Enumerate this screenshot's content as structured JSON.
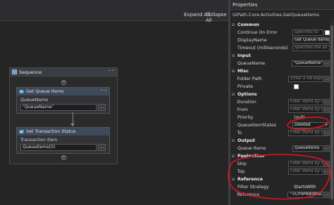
{
  "designer": {
    "expand_all": "Expand All",
    "collapse_all": "Collapse All",
    "sequence": {
      "title": "Sequence",
      "activities": [
        {
          "title": "Get Queue Items",
          "field_label": "QueueName",
          "field_value": "\"QueueName\""
        },
        {
          "title": "Set Transaction Status",
          "field_label": "Transaction Item",
          "field_value": "QueueItems(0)"
        }
      ]
    },
    "browse_button": "..."
  },
  "properties": {
    "title": "Properties",
    "type_name": "UiPath.Core.Activities.GetQueueItems",
    "categories": [
      {
        "name": "Common",
        "rows": [
          {
            "name": "Continue On Error",
            "value": "Specifies to",
            "placeholder": true,
            "control": "checkbox"
          },
          {
            "name": "DisplayName",
            "value": "Get Queue Items"
          },
          {
            "name": "Timeout (milliseconds)",
            "value": "Specifies the an",
            "placeholder": true
          }
        ]
      },
      {
        "name": "Input",
        "rows": [
          {
            "name": "QueueName",
            "value": "\"QueueName\"",
            "control": "dots"
          }
        ]
      },
      {
        "name": "Misc",
        "rows": [
          {
            "name": "Folder Path",
            "value": "Enter a VB expr",
            "placeholder": true,
            "control": "dots"
          },
          {
            "name": "Private",
            "control": "checkbox"
          }
        ]
      },
      {
        "name": "Options",
        "rows": [
          {
            "name": "Duration",
            "value": "Filter items by r",
            "placeholder": true,
            "control": "dots"
          },
          {
            "name": "From",
            "value": "Filter items by r",
            "placeholder": true,
            "control": "dots"
          },
          {
            "name": "Priority",
            "value": "(null)",
            "control": "text"
          },
          {
            "name": "QueueItemStates",
            "value": "Deleted",
            "control": "dropdown"
          },
          {
            "name": "To",
            "value": "Filter items by r",
            "placeholder": true,
            "control": "dots"
          }
        ]
      },
      {
        "name": "Output",
        "rows": [
          {
            "name": "Queue Items",
            "value": "QueueItems",
            "control": "dots"
          }
        ]
      },
      {
        "name": "Pagination",
        "rows": [
          {
            "name": "Skip",
            "value": "Filter items by r",
            "placeholder": true,
            "control": "dots"
          },
          {
            "name": "Top",
            "value": "Filter items by r",
            "placeholder": true,
            "control": "dots"
          }
        ]
      },
      {
        "name": "Reference",
        "rows": [
          {
            "name": "Filter Strategy",
            "value": "StartsWith",
            "control": "text"
          },
          {
            "name": "Reference",
            "value": "\"<CP0PR80MBC",
            "control": "dots"
          }
        ]
      }
    ]
  },
  "colors": {
    "annotation": "#e0121b",
    "background": "#252526",
    "header": "#3e4a5a"
  }
}
